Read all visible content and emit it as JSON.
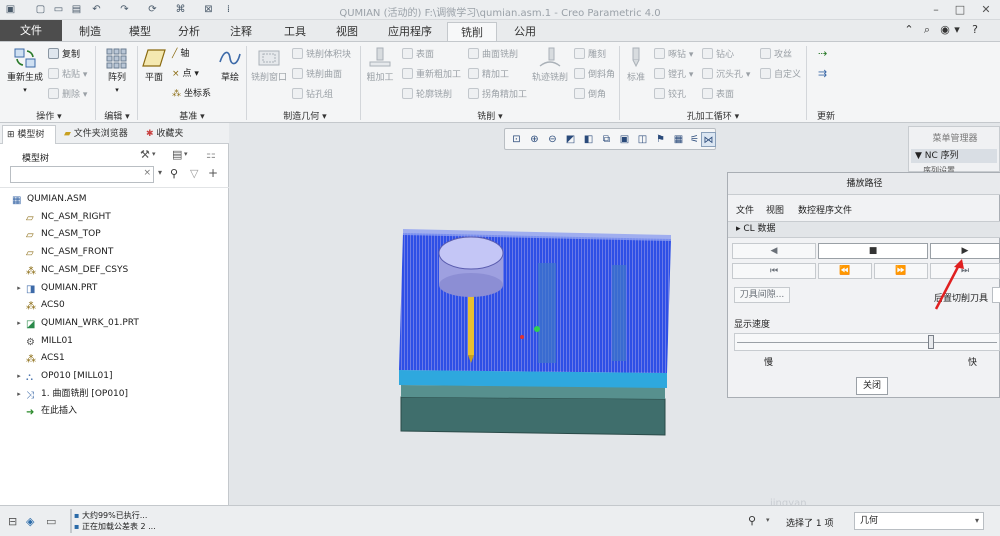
{
  "window": {
    "title": "QUMIAN (活动的) F:\\调微学习\\qumian.asm.1 - Creo Parametric 4.0"
  },
  "quick_access": {
    "icons": [
      "app-icon",
      "new-icon",
      "open-icon",
      "save-icon",
      "undo-icon",
      "redo-icon",
      "regenerate-icon",
      "windows-icon",
      "close-window-icon"
    ]
  },
  "window_controls": {
    "minimize": "–",
    "maximize": "□",
    "close": "✕",
    "help": "?"
  },
  "tabs": [
    {
      "label": "文件"
    },
    {
      "label": "制造"
    },
    {
      "label": "模型"
    },
    {
      "label": "分析"
    },
    {
      "label": "注释"
    },
    {
      "label": "工具"
    },
    {
      "label": "视图"
    },
    {
      "label": "应用程序"
    },
    {
      "label": "铣削"
    },
    {
      "label": "公用"
    }
  ],
  "ribbon": {
    "groups": {
      "operations": "操作 ▾",
      "edit": "编辑 ▾",
      "datum": "基准 ▾",
      "mfg_geometry": "制造几何 ▾",
      "milling": "铣削 ▾",
      "hole_cycle": "孔加工循环 ▾",
      "update": "更新"
    },
    "operations": {
      "regenerate": "重新生成",
      "copy": "复制",
      "paste": "粘贴 ▾",
      "delete": "删除 ▾"
    },
    "edit": {
      "pattern": "阵列"
    },
    "datum": {
      "plane": "平面",
      "axis": "轴",
      "point": "点 ▾",
      "csys": "坐标系",
      "sketch": "草绘"
    },
    "mfg_geometry": {
      "mill_window": "铣削窗口",
      "mill_volume": "铣削体积块",
      "mill_surface": "铣削曲面",
      "drill_group": "钻孔组"
    },
    "milling": {
      "roughing": "粗加工",
      "face": "表面",
      "re_rough": "重新粗加工",
      "profile": "轮廓铣削",
      "surface_mill": "曲面铣削",
      "finishing": "精加工",
      "corner_finish": "拐角精加工",
      "trajectory": "轨迹铣削",
      "engrave": "雕刻",
      "chamfer": "倒斜角",
      "round": "倒角"
    },
    "hole_cycle": {
      "standard": "标准",
      "spot_drill": "啄钻 ▾",
      "boring": "镗孔 ▾",
      "ream": "铰孔",
      "countersink": "钻心",
      "counterbore": "沉头孔 ▾",
      "tapping": "攻丝",
      "custom": "自定义",
      "back_face": "表面"
    }
  },
  "left_panel": {
    "tabs": [
      "模型树",
      "文件夹浏览器",
      "收藏夹"
    ],
    "header": "模型树",
    "search_placeholder": "",
    "tree": [
      {
        "label": "QUMIAN.ASM",
        "icon": "assembly-icon",
        "indent": 0,
        "expandable": false
      },
      {
        "label": "NC_ASM_RIGHT",
        "icon": "datum-plane-icon",
        "indent": 1,
        "expandable": false
      },
      {
        "label": "NC_ASM_TOP",
        "icon": "datum-plane-icon",
        "indent": 1,
        "expandable": false
      },
      {
        "label": "NC_ASM_FRONT",
        "icon": "datum-plane-icon",
        "indent": 1,
        "expandable": false
      },
      {
        "label": "NC_ASM_DEF_CSYS",
        "icon": "csys-icon",
        "indent": 1,
        "expandable": false
      },
      {
        "label": "QUMIAN.PRT",
        "icon": "part-icon",
        "indent": 1,
        "expandable": true
      },
      {
        "label": "ACS0",
        "icon": "csys-icon",
        "indent": 1,
        "expandable": false
      },
      {
        "label": "QUMIAN_WRK_01.PRT",
        "icon": "workpiece-icon",
        "indent": 1,
        "expandable": true
      },
      {
        "label": "MILL01",
        "icon": "mill-icon",
        "indent": 1,
        "expandable": false
      },
      {
        "label": "ACS1",
        "icon": "csys-icon",
        "indent": 1,
        "expandable": false
      },
      {
        "label": "OP010 [MILL01]",
        "icon": "operation-icon",
        "indent": 1,
        "expandable": true
      },
      {
        "label": "1. 曲面铣削 [OP010]",
        "icon": "sequence-icon",
        "indent": 1,
        "expandable": true
      },
      {
        "label": "在此插入",
        "icon": "insert-here-icon",
        "indent": 1,
        "expandable": false
      }
    ]
  },
  "menu_manager": {
    "title": "菜单管理器",
    "item": "▼ NC 序列",
    "subitem": "序列设置"
  },
  "playback_dialog": {
    "title": "播放路径",
    "menu": [
      "文件",
      "视图",
      "数控程序文件"
    ],
    "cl_section": "▸ CL 数据",
    "buttons": {
      "back": "◀",
      "stop": "■",
      "play": "▶",
      "rewind": "⏮",
      "step_back": "⏪",
      "step_fwd": "⏩",
      "end": "⏭"
    },
    "tool_clearance": "刀具间隙...",
    "post_tool": "后置切削刀具",
    "speed_label": "显示速度",
    "slow": "慢",
    "fast": "快",
    "speed_value": 0.75,
    "close": "关闭"
  },
  "status": {
    "messages": [
      "大约99%已执行...",
      "正在加载公差表 2 ..."
    ],
    "selection": "选择了 1 项",
    "filter_value": "几何"
  },
  "colors": {
    "file_tab": "#4d4d4d",
    "ribbon_bg": "#f4f5f6",
    "canvas_bg": "#e3e6e9",
    "toolpath_blue": "#2f53e8",
    "workpiece_top": "#35b0e0",
    "tool_shank": "#e8c030",
    "tool_holder": "#b0b4f0",
    "red_arrow": "#e02020"
  }
}
